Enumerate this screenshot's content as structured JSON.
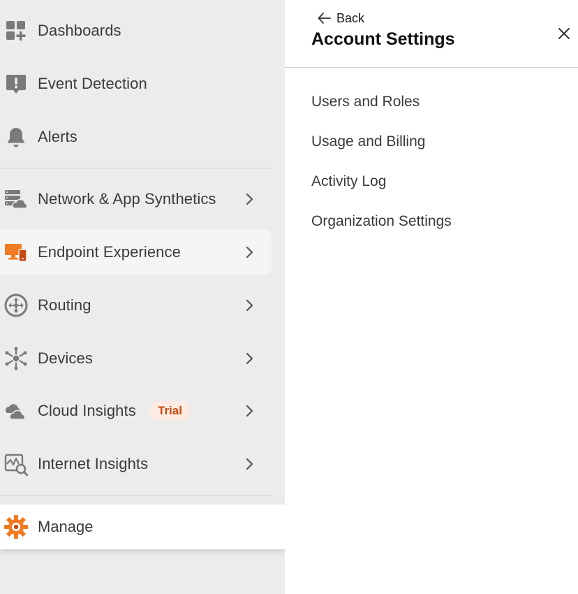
{
  "sidebar": {
    "items": [
      {
        "label": "Dashboards",
        "icon": "dashboard-add-icon"
      },
      {
        "label": "Event Detection",
        "icon": "alert-exclamation-icon"
      },
      {
        "label": "Alerts",
        "icon": "bell-icon"
      },
      {
        "label": "Network & App Synthetics",
        "icon": "server-cloud-icon"
      },
      {
        "label": "Endpoint Experience",
        "icon": "monitor-device-icon"
      },
      {
        "label": "Routing",
        "icon": "routing-arrows-icon"
      },
      {
        "label": "Devices",
        "icon": "device-hub-icon"
      },
      {
        "label": "Cloud Insights",
        "icon": "clouds-icon",
        "badge": "Trial"
      },
      {
        "label": "Internet Insights",
        "icon": "chart-search-icon"
      }
    ],
    "manage": {
      "label": "Manage",
      "icon": "gear-icon"
    }
  },
  "panel": {
    "back_label": "Back",
    "title": "Account Settings",
    "links": [
      "Users and Roles",
      "Usage and Billing",
      "Activity Log",
      "Organization Settings"
    ]
  },
  "colors": {
    "sidebar_bg": "#ececec",
    "accent_orange": "#f07b22",
    "badge_bg": "#fdeae0",
    "badge_text": "#c44a12",
    "icon_gray": "#7a7a7a"
  }
}
